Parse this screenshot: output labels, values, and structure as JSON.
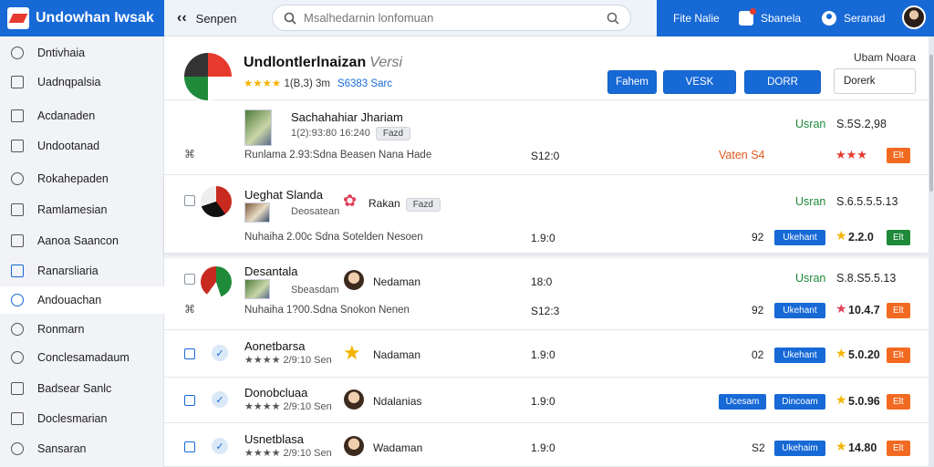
{
  "app": {
    "logo_text": "Undowhan Iwsak",
    "back_label": "Senpen",
    "search_placeholder": "Msalhedarnin lonfomuan",
    "right_items": [
      "Fite Nalie",
      "Sbanela",
      "Seranad"
    ]
  },
  "sidebar": {
    "items": [
      {
        "label": "Dntivhaia",
        "icon": "gear-icon"
      },
      {
        "label": "Uadnqpalsia",
        "icon": "document-icon"
      },
      {
        "label": "Acdanaden",
        "icon": "chart-icon"
      },
      {
        "label": "Undootanad",
        "icon": "list-icon"
      },
      {
        "label": "Rokahepaden",
        "icon": "globe-icon"
      },
      {
        "label": "Ramlamesian",
        "icon": "table-icon"
      },
      {
        "label": "Aanoa Saancon",
        "icon": "folder-icon"
      },
      {
        "label": "Ranarsliaria",
        "icon": "bar-chart-icon"
      },
      {
        "label": "Andouachan",
        "icon": "user-icon",
        "active": true
      },
      {
        "label": "Ronmarn",
        "icon": "chat-icon"
      },
      {
        "label": "Conclesamadaum",
        "icon": "info-icon"
      },
      {
        "label": "Badsear Sanlc",
        "icon": "tag-icon"
      },
      {
        "label": "Doclesmarian",
        "icon": "menu-icon"
      },
      {
        "label": "Sansaran",
        "icon": "settings-icon"
      }
    ]
  },
  "header": {
    "title_main": "Undlontlerlnaizan",
    "title_accent": "",
    "title_light": "Versi",
    "stars": "★★★★",
    "meta": "1(B,3) 3m",
    "meta_blue": "S6383   Sarc",
    "corner": "Ubam Noara",
    "buttons": [
      "Fahem",
      "VESK",
      "DORR",
      "Dorerk"
    ]
  },
  "rows": [
    {
      "title": "Sachahahiar Jhariam",
      "sub": "1(2):93:80 16:240",
      "pill": "Fazd",
      "line3": "Runlama   2.93:Sdna   Beasen Nana Hade",
      "mid": "S12:0",
      "usr": "Usran",
      "price": "S.5S.2,98",
      "warn": "Vaten S4",
      "stars": "★★★",
      "badge": "Elt"
    },
    {
      "title": "Ueghat Slanda",
      "sub": "Deosatean",
      "mid_label": "Rakan",
      "pill": "Fazd",
      "line3": "Nuhaiha   2.00c Sdna   Sotelden Nesoen",
      "mid": "1.9:0",
      "usr": "Usran",
      "price": "S.6.5.5.5.13",
      "count": "92",
      "chip": "Ukehant",
      "amount": "2.2.0",
      "badge": "Elt"
    },
    {
      "title": "Desantala",
      "sub": "Sbeasdam",
      "mid_label": "Nedaman",
      "line3": "Nuhaiha   1?00.Sdna   Snokon Nenen",
      "mid": "18:0",
      "mid2": "S12:3",
      "usr": "Usran",
      "price": "S.8.S5.5.13",
      "count": "92",
      "chip": "Ukehant",
      "amount": "10.4.7",
      "badge": "Elt"
    },
    {
      "title": "Aonetbarsa",
      "sub": "★★★★ 2/9:10 Sen",
      "mid_label": "Nadaman",
      "mid": "1.9:0",
      "count": "02",
      "chip": "Ukehant",
      "amount": "5.0.20",
      "badge": "Elt"
    },
    {
      "title": "Donobcluaa",
      "sub": "★★★★ 2/9:10 Sen",
      "mid_label": "Ndalanias",
      "mid": "1.9:0",
      "chip_extra": "Ucesam",
      "chip": "Dincoam",
      "amount": "5.0.96",
      "badge": "Elt"
    },
    {
      "title": "Usnetblasa",
      "sub": "★★★★ 2/9:10 Sen",
      "mid_label": "Wadaman",
      "mid": "1.9:0",
      "count": "S2",
      "chip": "Ukehaim",
      "amount": "14.80",
      "badge": "Elt"
    }
  ]
}
